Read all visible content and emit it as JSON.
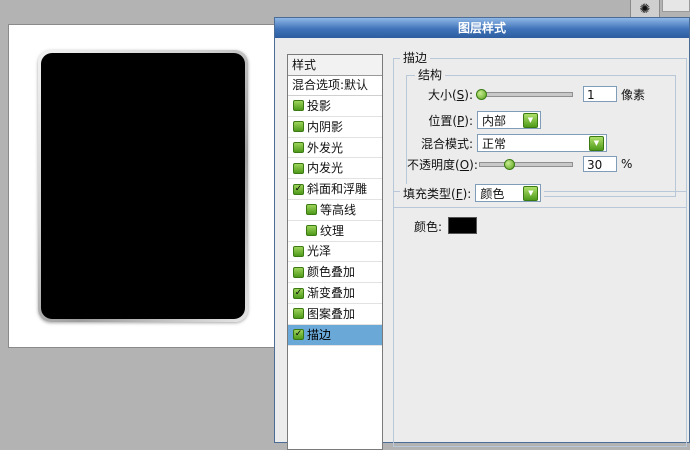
{
  "dialog": {
    "title": "图层样式"
  },
  "style_list": {
    "header": "样式",
    "blending_options": "混合选项:默认",
    "items": [
      {
        "label": "投影",
        "checked": false
      },
      {
        "label": "内阴影",
        "checked": false
      },
      {
        "label": "外发光",
        "checked": false
      },
      {
        "label": "内发光",
        "checked": false
      },
      {
        "label": "斜面和浮雕",
        "checked": true
      },
      {
        "label": "等高线",
        "checked": false
      },
      {
        "label": "纹理",
        "checked": false
      },
      {
        "label": "光泽",
        "checked": false
      },
      {
        "label": "颜色叠加",
        "checked": false
      },
      {
        "label": "渐变叠加",
        "checked": true
      },
      {
        "label": "图案叠加",
        "checked": false
      },
      {
        "label": "描边",
        "checked": true,
        "selected": true
      }
    ]
  },
  "stroke": {
    "section_title": "描边",
    "structure_title": "结构",
    "size": {
      "label_pre": "大小(",
      "key": "S",
      "label_post": "):",
      "value": "1",
      "unit": "像素",
      "slider_fraction": 0.0
    },
    "position": {
      "label_pre": "位置(",
      "key": "P",
      "label_post": "):",
      "value": "内部"
    },
    "blend_mode": {
      "label": "混合模式:",
      "value": "正常"
    },
    "opacity": {
      "label_pre": "不透明度(",
      "key": "O",
      "label_post": "):",
      "value": "30",
      "unit": "%",
      "slider_fraction": 0.3
    }
  },
  "fill": {
    "type_label_pre": "填充类型(",
    "type_key": "F",
    "type_label_post": "):",
    "type_value": "颜色",
    "color_label": "颜色:",
    "color_value": "#000000"
  },
  "colors": {
    "titlebar": "#3f73b9",
    "selected_row": "#6aa8d8",
    "checkbox_green": "#4e9a1b"
  },
  "icons": {
    "checkbox": "checkbox-icon",
    "dropdown": "dropdown-arrow-icon",
    "slider": "slider-thumb-icon",
    "toolbar": "gear-icon"
  }
}
